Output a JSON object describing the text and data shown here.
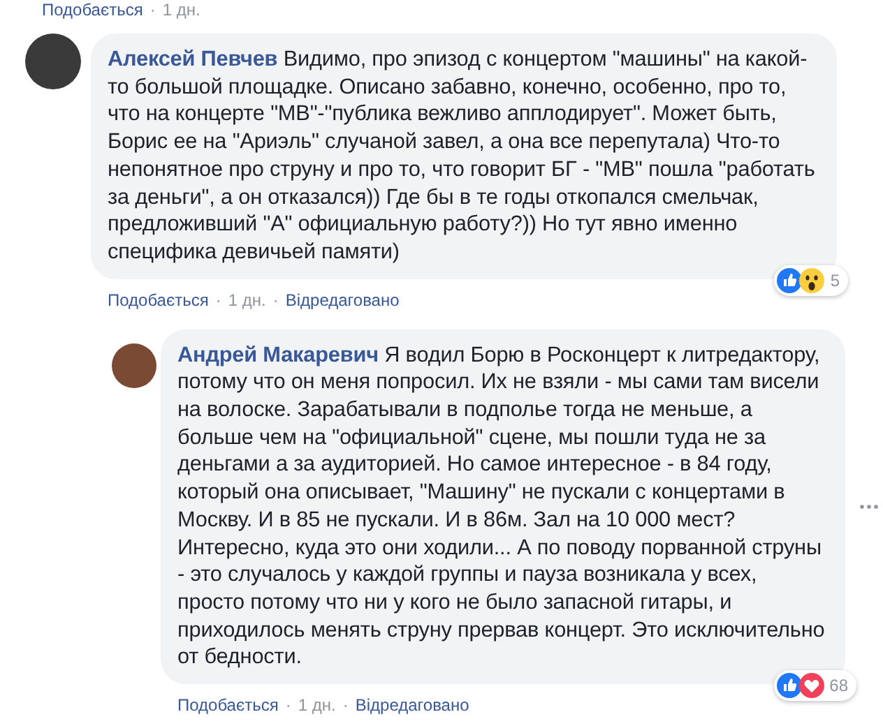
{
  "previous_comment": {
    "meta": [
      {
        "kind": "link",
        "text": "Подобається"
      },
      {
        "kind": "sep",
        "text": "·"
      },
      {
        "kind": "time",
        "text": "1 дн."
      }
    ]
  },
  "comments": [
    {
      "reply": false,
      "author": "Алексей Певчев",
      "text": "Видимо, про эпизод с концертом \"машины\" на какой-то большой площадке. Описано забавно, конечно, особенно, про то, что на концерте \"МВ\"-\"публика вежливо апплодирует\". Может быть, Борис ее на \"Ариэль\" случаной завел, а она все перепутала) Что-то непонятное про струну и про то, что говорит БГ - \"МВ\" пошла \"работать за деньги\", а он отказался)) Где бы в те годы откопался смельчак, предложивший \"А\" официальную работу?)) Но тут явно именно специфика девичьей памяти)",
      "reactions": [
        {
          "kind": "like"
        },
        {
          "kind": "wow"
        }
      ],
      "reaction_count": "5",
      "options": false,
      "meta": [
        {
          "kind": "link",
          "text": "Подобається"
        },
        {
          "kind": "sep",
          "text": "·"
        },
        {
          "kind": "time",
          "text": "1 дн."
        },
        {
          "kind": "sep",
          "text": "·"
        },
        {
          "kind": "edited",
          "text": "Відредаговано"
        }
      ]
    },
    {
      "reply": true,
      "author": "Андрей Макаревич",
      "text": "Я водил Борю в Росконцерт к литредактору, потому что он меня попросил. Их не взяли - мы сами там висели на волоске. Зарабатывали в подполье тогда не меньше, а больше чем на \"официальной\" сцене, мы пошли туда не за деньгами а за аудиторией. Но самое интересное - в 84 году, который она описывает, \"Машину\" не пускали с концертами в Москву. И в 85 не пускали. И в 86м. Зал на 10 000 мест? Интересно, куда это они ходили... А по поводу порванной струны - это случалось у каждой группы и пауза возникала у всех, просто потому что ни у кого не было запасной гитары, и приходилось менять струну прервав концерт. Это исключительно от бедности.",
      "reactions": [
        {
          "kind": "like"
        },
        {
          "kind": "love"
        }
      ],
      "reaction_count": "68",
      "options": true,
      "meta": [
        {
          "kind": "link",
          "text": "Подобається"
        },
        {
          "kind": "sep",
          "text": "·"
        },
        {
          "kind": "time",
          "text": "1 дн."
        },
        {
          "kind": "sep",
          "text": "·"
        },
        {
          "kind": "edited",
          "text": "Відредаговано"
        }
      ]
    }
  ]
}
